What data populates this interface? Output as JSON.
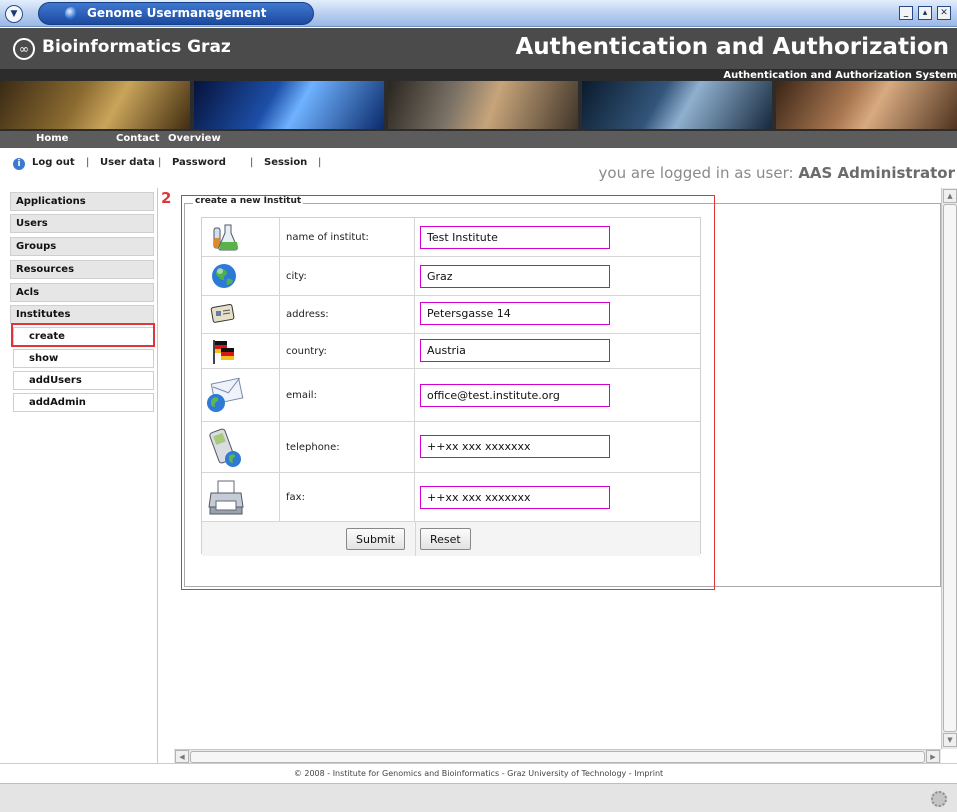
{
  "window": {
    "title": "Genome Usermanagement"
  },
  "header": {
    "brand": "Bioinformatics Graz",
    "title": "Authentication and Authorization",
    "subtitle": "Authentication and Authorization System"
  },
  "nav": {
    "items": [
      {
        "label": "Home"
      },
      {
        "label": "Contact"
      },
      {
        "label": "Overview"
      }
    ]
  },
  "subnav": {
    "items": [
      {
        "label": "Log out"
      },
      {
        "label": "User data"
      },
      {
        "label": "Password"
      },
      {
        "label": "Session"
      }
    ],
    "separator": "|",
    "logged_in_prefix": "you are logged in as user: ",
    "logged_in_user": "AAS Administrator"
  },
  "sidebar": {
    "categories": [
      {
        "label": "Applications"
      },
      {
        "label": "Users"
      },
      {
        "label": "Groups"
      },
      {
        "label": "Resources"
      },
      {
        "label": "Acls"
      },
      {
        "label": "Institutes"
      }
    ],
    "sub_items": [
      {
        "label": "create"
      },
      {
        "label": "show"
      },
      {
        "label": "addUsers"
      },
      {
        "label": "addAdmin"
      }
    ],
    "active_sub_item": "create"
  },
  "main": {
    "marker": "2",
    "legend": "create a new Institut",
    "fields": [
      {
        "label": "name of institut:",
        "value": "Test Institute",
        "icon": "lab-flask-icon"
      },
      {
        "label": "city:",
        "value": "Graz",
        "icon": "globe-icon"
      },
      {
        "label": "address:",
        "value": "Petersgasse 14",
        "icon": "address-card-icon"
      },
      {
        "label": "country:",
        "value": "Austria",
        "icon": "flags-icon"
      },
      {
        "label": "email:",
        "value": "office@test.institute.org",
        "icon": "email-envelope-icon"
      },
      {
        "label": "telephone:",
        "value": "++xx xxx xxxxxxx",
        "icon": "mobile-phone-icon"
      },
      {
        "label": "fax:",
        "value": "++xx xxx xxxxxxx",
        "icon": "fax-printer-icon"
      }
    ],
    "submit_label": "Submit",
    "reset_label": "Reset"
  },
  "footer": {
    "text": "© 2008 - Institute for Genomics and Bioinformatics - Graz University of Technology - Imprint"
  },
  "colors": {
    "highlight_red": "#e0363b",
    "input_border_magenta": "#d200d2",
    "header_bg": "#4b4b4b",
    "nav_bg": "#5c5c5c"
  }
}
